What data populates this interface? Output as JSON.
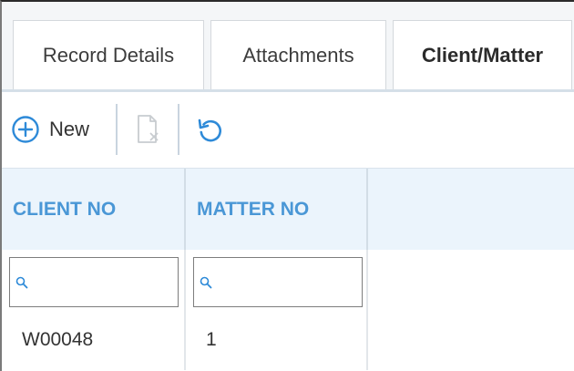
{
  "tabs": [
    {
      "label": "Record Details",
      "active": false
    },
    {
      "label": "Attachments",
      "active": false
    },
    {
      "label": "Client/Matter",
      "active": true
    }
  ],
  "toolbar": {
    "new_label": "New",
    "new_icon": "plus-circle-icon",
    "delete_icon": "delete-document-icon",
    "refresh_icon": "refresh-icon"
  },
  "grid": {
    "columns": [
      "CLIENT NO",
      "MATTER NO"
    ],
    "filter_icon": "search-icon",
    "rows": [
      {
        "client_no": "W00048",
        "matter_no": "1"
      }
    ]
  },
  "colors": {
    "accent": "#2e8ad8",
    "header_text": "#4a97d6",
    "header_bg": "#ebf4fc"
  }
}
